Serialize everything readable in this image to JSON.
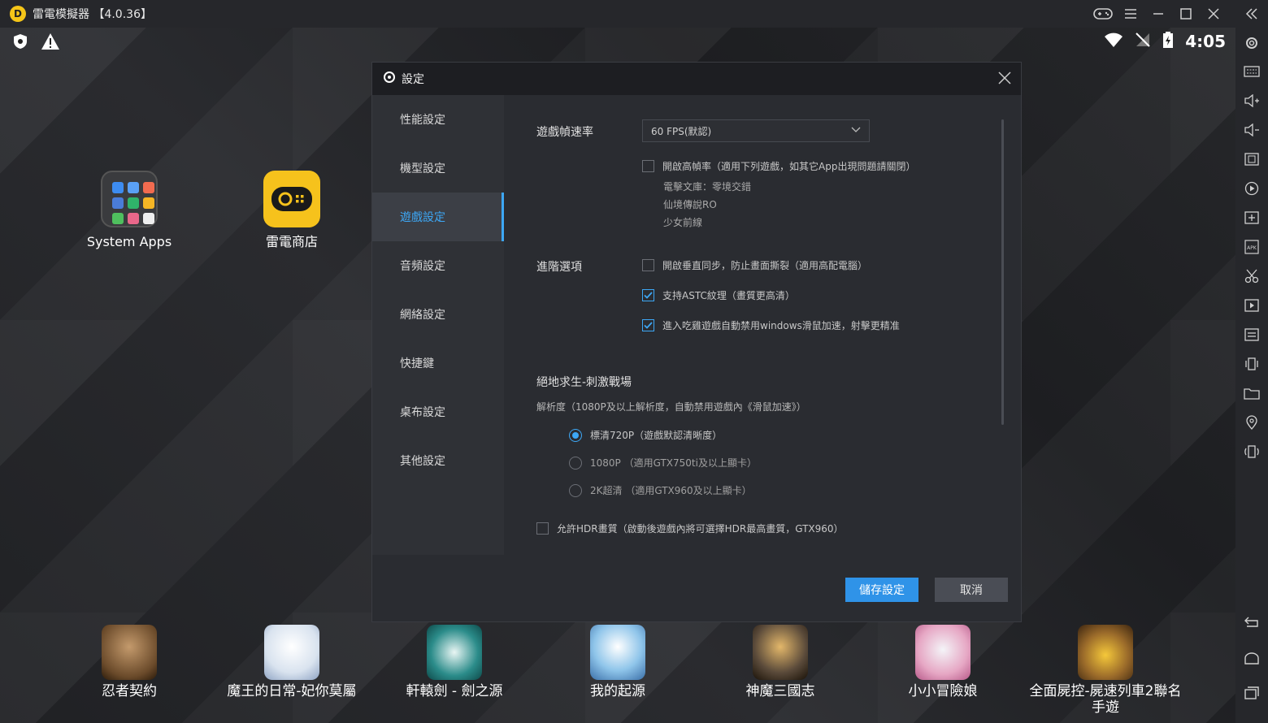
{
  "window": {
    "title": "雷電模擬器 【4.0.36】",
    "logo_letter": "D",
    "icons": [
      "gamepad-icon",
      "menu-icon",
      "minimize-icon",
      "maximize-icon",
      "close-icon"
    ]
  },
  "statusbar": {
    "time": "4:05"
  },
  "desktop": {
    "icons": [
      {
        "label": "System Apps"
      },
      {
        "label": "雷電商店"
      }
    ],
    "dock": [
      {
        "label": "忍者契約",
        "color": "#6a4a2a"
      },
      {
        "label": "魔王的日常-妃你莫屬",
        "color": "#d9e3ef"
      },
      {
        "label": "軒轅劍 - 劍之源",
        "color": "#2b8c8a"
      },
      {
        "label": "我的起源",
        "color": "#8fc5ea"
      },
      {
        "label": "神魔三國志",
        "color": "#5a4a3a"
      },
      {
        "label": "小小冒險娘",
        "color": "#e6a7c4"
      },
      {
        "label": "全面屍控-屍速列車2聯名手遊",
        "color": "#9a6a2a"
      }
    ]
  },
  "dialog": {
    "title": "設定",
    "nav": [
      {
        "label": "性能設定",
        "active": false
      },
      {
        "label": "機型設定",
        "active": false
      },
      {
        "label": "遊戲設定",
        "active": true
      },
      {
        "label": "音頻設定",
        "active": false
      },
      {
        "label": "網絡設定",
        "active": false
      },
      {
        "label": "快捷鍵",
        "active": false
      },
      {
        "label": "桌布設定",
        "active": false
      },
      {
        "label": "其他設定",
        "active": false
      }
    ],
    "fps": {
      "label": "遊戲幀速率",
      "value": "60 FPS(默認)",
      "high_fps_option": "開啟高幀率（適用下列遊戲，如其它App出現問題請關閉）",
      "games": [
        "電擊文庫：零境交錯",
        "仙境傳說RO",
        "少女前線"
      ]
    },
    "advanced": {
      "label": "進階選項",
      "options": [
        {
          "label": "開啟垂直同步，防止畫面撕裂（適用高配電腦）",
          "checked": false
        },
        {
          "label": "支持ASTC紋理（畫質更高清）",
          "checked": true
        },
        {
          "label": "進入吃雞遊戲自動禁用windows滑鼠加速，射擊更精准",
          "checked": true
        }
      ]
    },
    "pubg": {
      "title": "絕地求生-刺激戰場",
      "resolution_note": "解析度（1080P及以上解析度，自動禁用遊戲內《滑鼠加速》）",
      "resolutions": [
        {
          "label": "標清720P（遊戲默認清晰度）",
          "selected": true
        },
        {
          "label": "1080P （適用GTX750ti及以上顯卡）",
          "selected": false
        },
        {
          "label": "2K超清 （適用GTX960及以上顯卡）",
          "selected": false
        }
      ],
      "hdr_option": "允許HDR畫質（啟動後遊戲內將可選擇HDR最高畫質，GTX960）"
    },
    "buttons": {
      "save": "儲存設定",
      "cancel": "取消"
    }
  },
  "colors": {
    "accent": "#3da7f5",
    "primary_button": "#2f93e8"
  }
}
